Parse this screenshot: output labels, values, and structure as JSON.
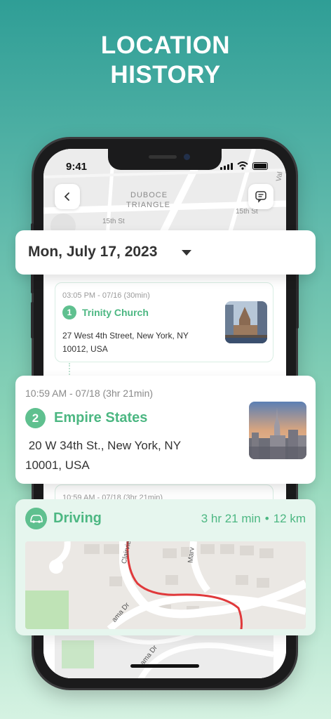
{
  "headline": {
    "line1": "LOCATION",
    "line2": "HISTORY"
  },
  "status": {
    "time": "9:41"
  },
  "map_labels": {
    "area1": "DUBOCE",
    "area2": "TRIANGLE",
    "street1": "15th St",
    "street2": "15th St",
    "street3": "Val"
  },
  "date_selector": {
    "label": "Mon, July 17, 2023"
  },
  "visit1": {
    "number": "1",
    "time": "03:05 PM - 07/16 (30min)",
    "name": "Trinity Church",
    "address_line1": "27 West 4th Street, New York, NY",
    "address_line2": "10012, USA"
  },
  "visit2": {
    "number": "2",
    "time": "10:59 AM - 07/18 (3hr 21min)",
    "name": "Empire States",
    "address_line1": " 20 W 34th St., New York, NY",
    "address_line2": "10001, USA"
  },
  "visit3": {
    "time": "10:59 AM - 07/18 (3hr 21min)"
  },
  "trip": {
    "mode": "Driving",
    "duration": "3 hr 21 min",
    "separator": "•",
    "distance": "12 km",
    "streets": {
      "a": "Clairvie",
      "b": "Marv",
      "c": "ama Dr",
      "d": "ama Dr"
    }
  },
  "colors": {
    "accent_green": "#4cb782",
    "route_red": "#e0393b"
  },
  "icons": [
    "back-chevron-icon",
    "chat-icon",
    "car-icon",
    "dropdown-caret-icon"
  ]
}
